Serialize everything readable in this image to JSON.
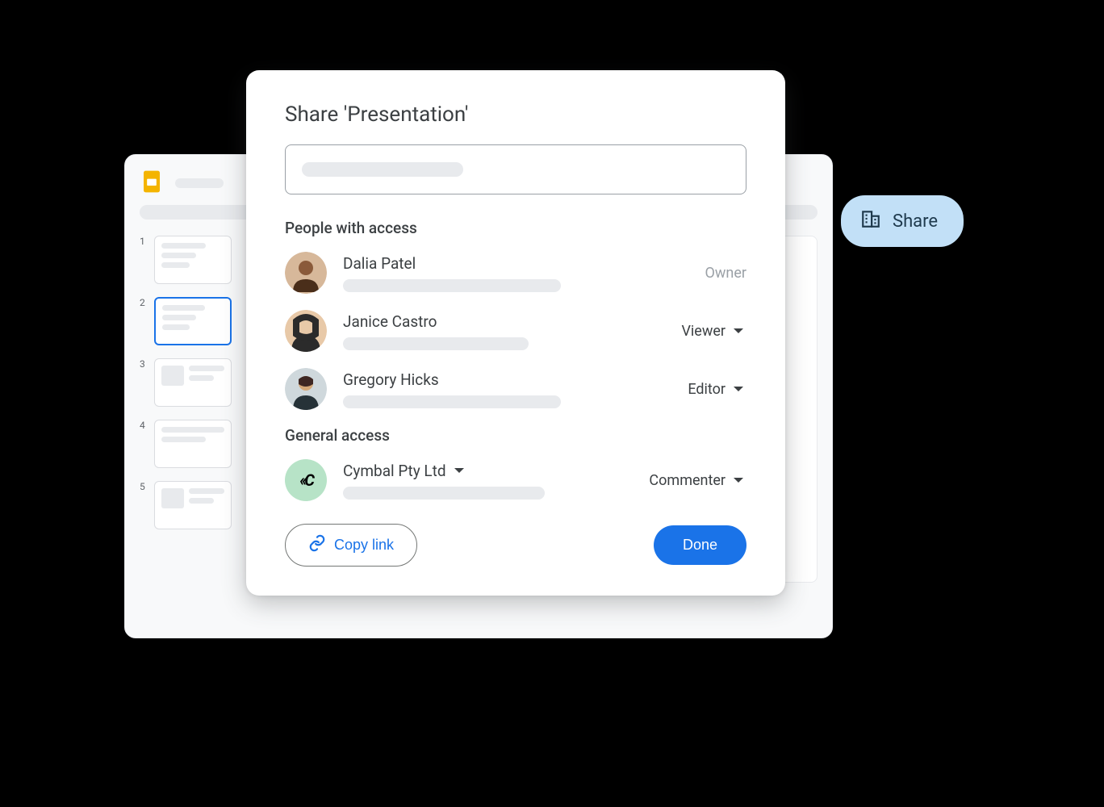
{
  "dialog": {
    "title": "Share 'Presentation'",
    "people_heading": "People with access",
    "general_heading": "General access",
    "copy_link_label": "Copy link",
    "done_label": "Done"
  },
  "people": [
    {
      "name": "Dalia Patel",
      "role": "Owner",
      "role_editable": false
    },
    {
      "name": "Janice Castro",
      "role": "Viewer",
      "role_editable": true
    },
    {
      "name": "Gregory Hicks",
      "role": "Editor",
      "role_editable": true
    }
  ],
  "general": {
    "org_name": "Cymbal Pty Ltd",
    "role": "Commenter"
  },
  "share_chip": {
    "label": "Share"
  },
  "thumbs": [
    "1",
    "2",
    "3",
    "4",
    "5"
  ],
  "thumbs_active_index": 1
}
